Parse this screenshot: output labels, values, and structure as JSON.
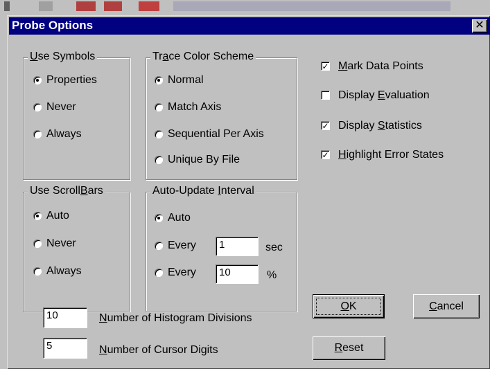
{
  "window": {
    "title": "Probe Options",
    "close_glyph": "✕"
  },
  "use_symbols": {
    "legend_pre": "",
    "legend_key": "U",
    "legend_post": "se Symbols",
    "options": [
      "Properties",
      "Never",
      "Always"
    ],
    "selected": 0
  },
  "trace_color": {
    "legend_pre": "Tr",
    "legend_key": "a",
    "legend_post": "ce Color Scheme",
    "options": [
      "Normal",
      "Match Axis",
      "Sequential Per Axis",
      "Unique By File"
    ],
    "selected": 0
  },
  "scrollbars": {
    "legend_pre": "Use Scroll",
    "legend_key": "B",
    "legend_post": "ars",
    "options": [
      "Auto",
      "Never",
      "Always"
    ],
    "selected": 0
  },
  "auto_update": {
    "legend_pre": "Auto-Update ",
    "legend_key": "I",
    "legend_post": "nterval",
    "auto_label": "Auto",
    "every_label": "Every",
    "every_sec_value": "1",
    "sec_unit": "sec",
    "every_pct_value": "10",
    "pct_unit": "%",
    "selected": 0
  },
  "checkboxes": {
    "mark_data_points": {
      "pre": "",
      "key": "M",
      "post": "ark Data Points",
      "checked": true
    },
    "display_evaluation": {
      "pre": "Display ",
      "key": "E",
      "post": "valuation",
      "checked": false
    },
    "display_statistics": {
      "pre": "Display ",
      "key": "S",
      "post": "tatistics",
      "checked": true
    },
    "highlight_error_states": {
      "pre": "",
      "key": "H",
      "post": "ighlight Error States",
      "checked": true
    }
  },
  "histogram": {
    "value": "10",
    "label_key": "N",
    "label_post": "umber of Histogram Divisions"
  },
  "cursor_digits": {
    "value": "5",
    "label_key": "N",
    "label_post": "umber of Cursor Digits"
  },
  "buttons": {
    "ok": {
      "key": "O",
      "post": "K"
    },
    "cancel": {
      "key": "C",
      "post": "ancel"
    },
    "reset": {
      "key": "R",
      "post": "eset"
    }
  },
  "colors": {
    "face": "#c0c0c0",
    "title_bar": "#000080",
    "shadow": "#808080",
    "highlight": "#ffffff"
  }
}
